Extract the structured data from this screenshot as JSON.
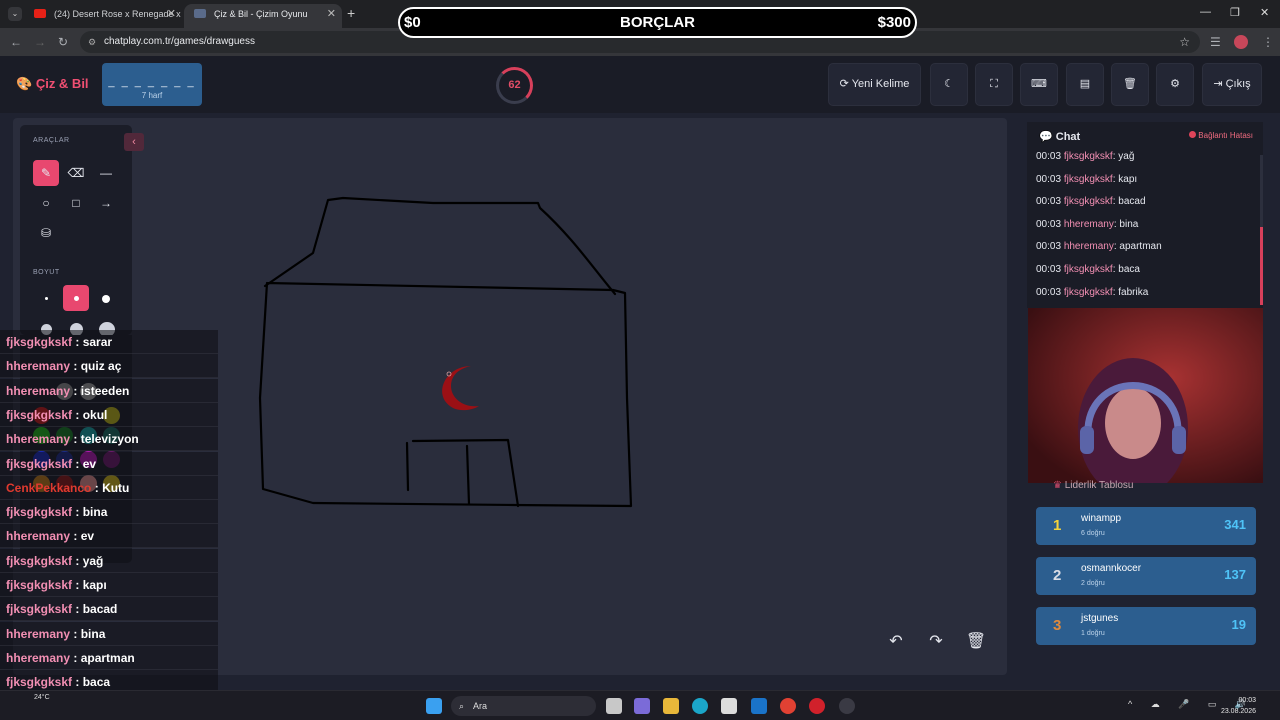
{
  "browser": {
    "tabs": [
      {
        "label": "(24) Desert Rose x Renegade x"
      },
      {
        "label": "Çiz & Bil - Çizim Oyunu"
      }
    ],
    "url": "chatplay.com.tr/games/drawguess",
    "new_tab_label": "+"
  },
  "banner": {
    "left": "$0",
    "title": "BORÇLAR",
    "right": "$300"
  },
  "header": {
    "logo": "Çiz & Bil",
    "word_mask": "_ _ _ _ _ _ _",
    "word_length": "7 harf",
    "timer": "62",
    "new_word": "Yeni Kelime",
    "exit": "Çıkış"
  },
  "tools": {
    "title": "ARAÇLAR",
    "size_title": "BOYUT"
  },
  "overlay_chat": [
    {
      "user": "fjksgkgkskf",
      "msg": "sarar"
    },
    {
      "user": "hheremany",
      "msg": "quiz aç"
    },
    {
      "user": "hheremany",
      "msg": "isteeden"
    },
    {
      "user": "fjksgkgkskf",
      "msg": "okul"
    },
    {
      "user": "hheremany",
      "msg": "televizyon"
    },
    {
      "user": "fjksgkgkskf",
      "msg": "ev"
    },
    {
      "user": "CenkPekkanco",
      "msg": "Kutu"
    },
    {
      "user": "fjksgkgkskf",
      "msg": "bina"
    },
    {
      "user": "hheremany",
      "msg": "ev"
    },
    {
      "user": "fjksgkgkskf",
      "msg": "yağ"
    },
    {
      "user": "fjksgkgkskf",
      "msg": "kapı"
    },
    {
      "user": "fjksgkgkskf",
      "msg": "bacad"
    },
    {
      "user": "hheremany",
      "msg": "bina"
    },
    {
      "user": "hheremany",
      "msg": "apartman"
    },
    {
      "user": "fjksgkgkskf",
      "msg": "baca"
    },
    {
      "user": "fjksgkgkskf",
      "msg": "fabrika"
    }
  ],
  "chat": {
    "title": "Chat",
    "status": "Bağlantı Hatası",
    "messages": [
      {
        "time": "00:03",
        "user": "fjksgkgkskf",
        "msg": "yağ"
      },
      {
        "time": "00:03",
        "user": "fjksgkgkskf",
        "msg": "kapı"
      },
      {
        "time": "00:03",
        "user": "fjksgkgkskf",
        "msg": "bacad"
      },
      {
        "time": "00:03",
        "user": "hheremany",
        "msg": "bina"
      },
      {
        "time": "00:03",
        "user": "hheremany",
        "msg": "apartman"
      },
      {
        "time": "00:03",
        "user": "fjksgkgkskf",
        "msg": "baca"
      },
      {
        "time": "00:03",
        "user": "fjksgkgkskf",
        "msg": "fabrika"
      }
    ]
  },
  "leaderboard": {
    "title": "Liderlik Tablosu",
    "rows": [
      {
        "rank": "1",
        "name": "winampp",
        "sub": "6 doğru",
        "points": "341",
        "color": "#f5d33a"
      },
      {
        "rank": "2",
        "name": "osmannkocer",
        "sub": "2 doğru",
        "points": "137",
        "color": "#d9dde6"
      },
      {
        "rank": "3",
        "name": "jstgunes",
        "sub": "1 doğru",
        "points": "19",
        "color": "#e08a3c"
      }
    ]
  },
  "taskbar": {
    "search": "Ara",
    "weather": "24°C",
    "time": "00:03",
    "date": "23.08.2026"
  },
  "colors": {
    "accent": "#e8486f",
    "panel_blue": "#2c5e8f",
    "drawing_stroke": "#000000",
    "drawing_red": "#9b1015"
  }
}
